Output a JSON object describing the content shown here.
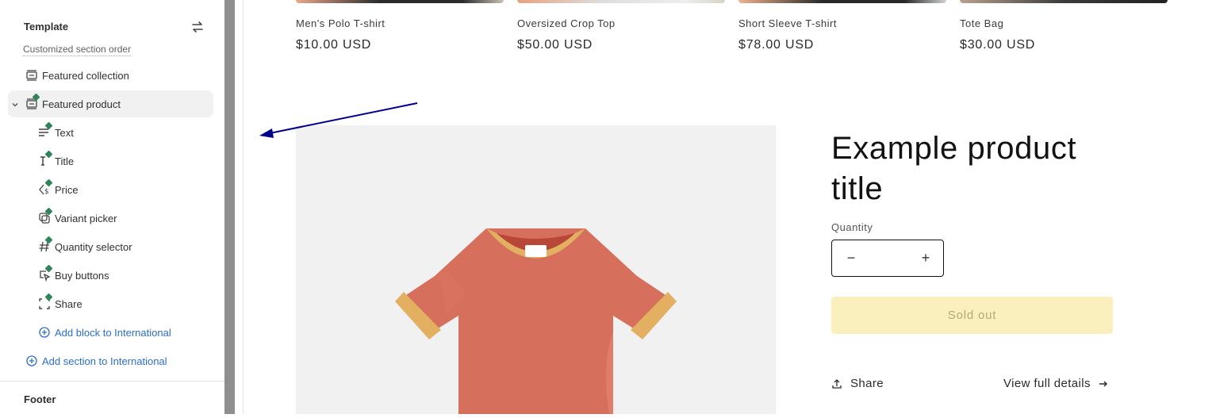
{
  "sidebar": {
    "title": "Template",
    "subtitle": "Customized section order",
    "items": [
      {
        "label": "Featured collection"
      },
      {
        "label": "Featured product"
      }
    ],
    "blocks": [
      {
        "label": "Text",
        "icon": "text-icon"
      },
      {
        "label": "Title",
        "icon": "title-icon"
      },
      {
        "label": "Price",
        "icon": "price-icon"
      },
      {
        "label": "Variant picker",
        "icon": "variant-picker-icon"
      },
      {
        "label": "Quantity selector",
        "icon": "hash-icon"
      },
      {
        "label": "Buy buttons",
        "icon": "pointer-icon"
      },
      {
        "label": "Share",
        "icon": "share-frame-icon"
      }
    ],
    "add_block": "Add block to International",
    "add_section": "Add section to International",
    "footer": "Footer"
  },
  "preview": {
    "products": [
      {
        "name": "Men's Polo T-shirt",
        "price": "$10.00 USD"
      },
      {
        "name": "Oversized Crop Top",
        "price": "$50.00 USD"
      },
      {
        "name": "Short Sleeve T-shirt",
        "price": "$78.00 USD"
      },
      {
        "name": "Tote Bag",
        "price": "$30.00 USD"
      }
    ],
    "product_title": "Example product title",
    "quantity_label": "Quantity",
    "quantity_value": "",
    "sold_out": "Sold out",
    "share": "Share",
    "view_full": "View full details"
  },
  "colors": {
    "accent_link": "#2c6ecb",
    "modified_dot": "#2f855a",
    "sold_out_bg": "#faf0bd",
    "annotation_arrow": "#00008b"
  }
}
